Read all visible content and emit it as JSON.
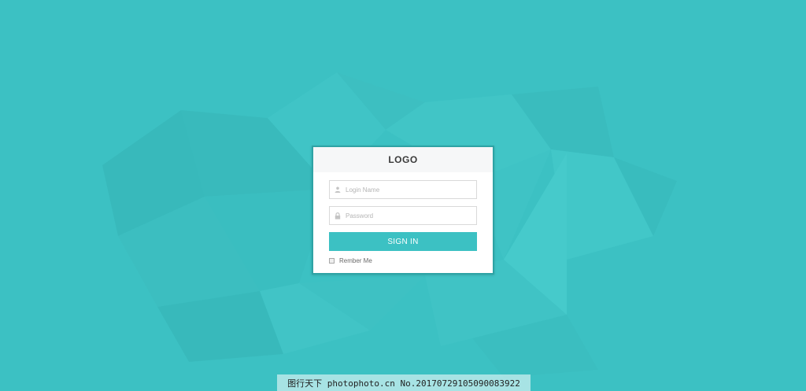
{
  "colors": {
    "background": "#3cc1c3",
    "accent": "#3cc1c3",
    "card_border": "#2ea3a5"
  },
  "login_card": {
    "logo": "LOGO",
    "login_field": {
      "placeholder": "Login Name",
      "value": "",
      "icon": "user-icon"
    },
    "password_field": {
      "placeholder": "Password",
      "value": "",
      "icon": "lock-icon"
    },
    "signin_label": "SIGN IN",
    "remember_label": "Rember Me",
    "remember_checked": false
  },
  "watermark": {
    "text": "图行天下 photophoto.cn No.20170729105090083922"
  }
}
